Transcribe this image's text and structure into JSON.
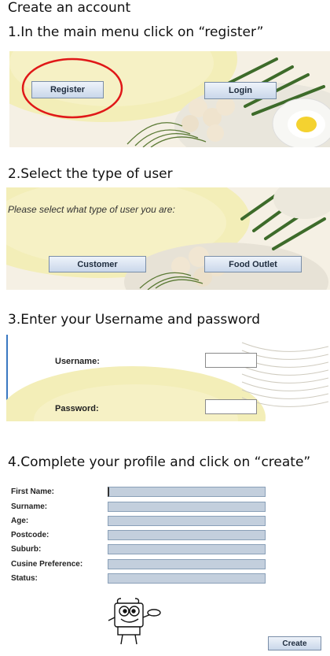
{
  "title": "Create an account",
  "steps": [
    {
      "text": "1.In the main menu click on “register”"
    },
    {
      "text": "2.Select the type of user"
    },
    {
      "text": "3.Enter your Username and password"
    },
    {
      "text": "4.Complete your profile and click on “create”"
    }
  ],
  "main_menu": {
    "register_label": "Register",
    "login_label": "Login"
  },
  "user_type": {
    "prompt": "Please select what type of user you are:",
    "customer_label": "Customer",
    "food_outlet_label": "Food Outlet"
  },
  "credentials": {
    "username_label": "Username:",
    "password_label": "Password:",
    "username_value": "",
    "password_value": ""
  },
  "profile": {
    "fields": [
      {
        "label": "First Name:",
        "value": ""
      },
      {
        "label": "Surname:",
        "value": ""
      },
      {
        "label": "Age:",
        "value": ""
      },
      {
        "label": "Postcode:",
        "value": ""
      },
      {
        "label": "Suburb:",
        "value": ""
      },
      {
        "label": "Cusine Preference:",
        "value": ""
      },
      {
        "label": "Status:",
        "value": ""
      }
    ],
    "create_label": "Create",
    "mascot_icon": "cartoon-chef-sponge-icon"
  },
  "colors": {
    "highlight_circle": "#e01818",
    "button_face": "#d6e1ef",
    "field_fill": "#c3cfdd"
  }
}
